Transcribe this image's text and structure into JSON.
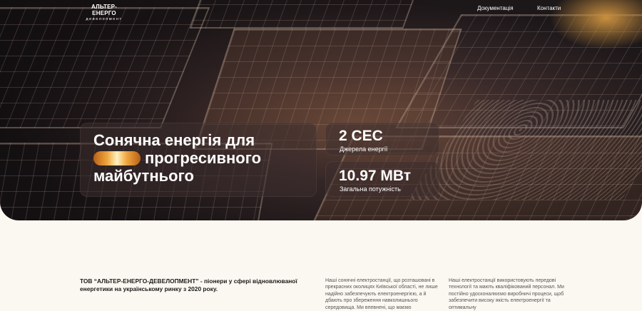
{
  "brand": {
    "name": "АЛЬТЕР-ЕНЕРГО",
    "subtitle": "девелопмент"
  },
  "nav": {
    "items": [
      {
        "label": "Документація"
      },
      {
        "label": "Контакти"
      }
    ]
  },
  "hero": {
    "headline_line1": "Сонячна енергія для",
    "headline_line2": "прогресивного",
    "headline_line3": "майбутнього"
  },
  "stats": [
    {
      "value": "2 СЕС",
      "label": "Джерела енергії"
    },
    {
      "value": "10.97 МВт",
      "label": "Загальна потужність"
    }
  ],
  "about": {
    "lead": "ТОВ “АЛЬТЕР-ЕНЕРГО-ДЕВЕЛОПМЕНТ” - піонери у сфері відновлюваної енергетики на українському ринку з 2020 року.",
    "col1": "Наші сонячні електростанції, що розташовані в прекрасних околицях Київської області, не лише надійно забезпечують електроенергією, а й дбають про збереження навколишнього середовища. Ми впевнені, що маємо",
    "col2": "Наші електростанції використовують передові технології та мають кваліфікований персонал. Ми постійно удосконалюємо виробничі процеси, щоб забезпечити високу якість електроенергії та оптимальну"
  },
  "colors": {
    "background": "#fbf8f1",
    "text": "#1d1b1a",
    "accent": "#f0a840"
  }
}
